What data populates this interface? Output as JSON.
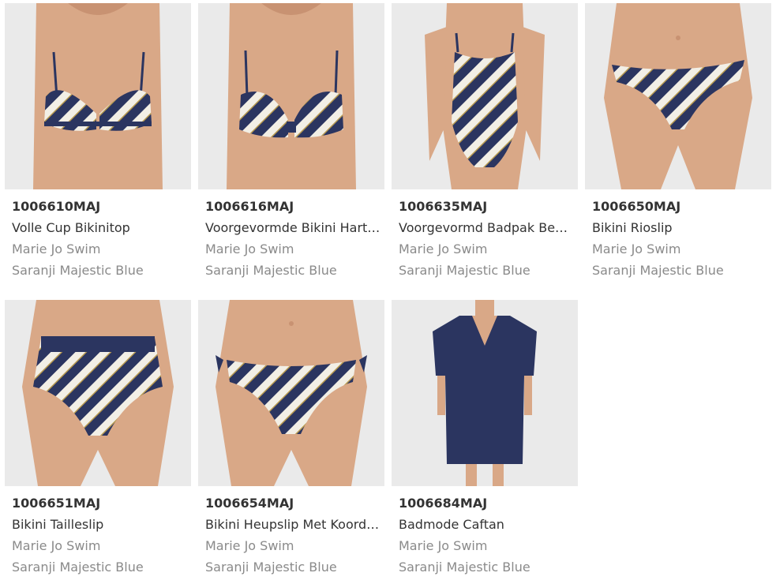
{
  "colors": {
    "skin": "#d9a887",
    "skin_shadow": "#c89272",
    "navy": "#2b3560",
    "cream": "#f2efe6",
    "gold": "#b79a50",
    "bg": "#eaeaea"
  },
  "products": [
    {
      "sku": "1006610MAJ",
      "name": "Volle Cup Bikinitop",
      "brand": "Marie Jo Swim",
      "color": "Saranji Majestic Blue",
      "image": "bikini-top-image"
    },
    {
      "sku": "1006616MAJ",
      "name": "Voorgevormde Bikini Hart…",
      "brand": "Marie Jo Swim",
      "color": "Saranji Majestic Blue",
      "image": "bikini-top-heart-image"
    },
    {
      "sku": "1006635MAJ",
      "name": "Voorgevormd Badpak Be…",
      "brand": "Marie Jo Swim",
      "color": "Saranji Majestic Blue",
      "image": "swimsuit-image"
    },
    {
      "sku": "1006650MAJ",
      "name": "Bikini Rioslip",
      "brand": "Marie Jo Swim",
      "color": "Saranji Majestic Blue",
      "image": "rio-brief-image"
    },
    {
      "sku": "1006651MAJ",
      "name": "Bikini Tailleslip",
      "brand": "Marie Jo Swim",
      "color": "Saranji Majestic Blue",
      "image": "waist-brief-image"
    },
    {
      "sku": "1006654MAJ",
      "name": "Bikini Heupslip Met Koord…",
      "brand": "Marie Jo Swim",
      "color": "Saranji Majestic Blue",
      "image": "tie-brief-image"
    },
    {
      "sku": "1006684MAJ",
      "name": "Badmode Caftan",
      "brand": "Marie Jo Swim",
      "color": "Saranji Majestic Blue",
      "image": "caftan-image"
    }
  ]
}
